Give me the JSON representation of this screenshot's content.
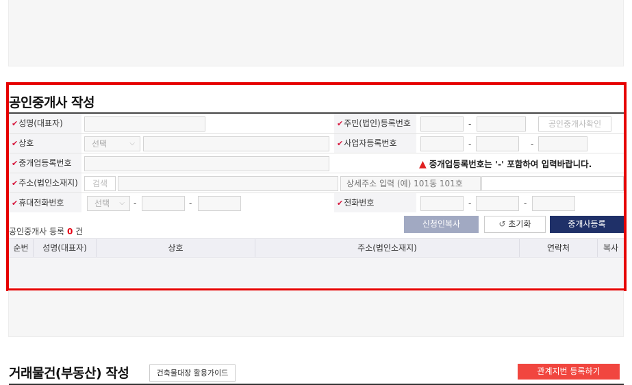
{
  "broker_section": {
    "title": "공인중개사 작성",
    "required_mark": "✔",
    "fields": {
      "name_label": "성명(대표자)",
      "rrn_label": "주민(법인)등록번호",
      "confirm_button": "공인중개사확인",
      "trade_name_label": "상호",
      "select_placeholder": "선택",
      "business_no_label": "사업자등록번호",
      "broker_reg_label": "중개업등록번호",
      "warning_text": "중개업등록번호는  '-' 포함하여 입력바랍니다.",
      "address_label": "주소(법인소재지)",
      "search_button": "검색",
      "address_detail_placeholder": "상세주소 입력 (예) 101동 101호",
      "mobile_label": "휴대전화번호",
      "phone_label": "전화번호",
      "dash": "-"
    },
    "count": {
      "prefix": "공인중개사 등록",
      "value": "0",
      "suffix": "건"
    },
    "actions": {
      "copy_applicant": "신청인복사",
      "reset": "초기화",
      "register": "중개사등록"
    },
    "table": {
      "columns": [
        "순번",
        "성명(대표자)",
        "상호",
        "주소(법인소재지)",
        "연락처",
        "복사"
      ]
    }
  },
  "deal_section": {
    "title": "거래물건(부동산) 작성",
    "guide_button": "건축물대장 활용가이드",
    "lot_button": "관계지번 등록하기"
  },
  "colors": {
    "highlight": "#e60000",
    "required": "#d6163c",
    "primary": "#1f3068",
    "secondary": "#a1a9c2",
    "accent_red": "#f1463f"
  }
}
